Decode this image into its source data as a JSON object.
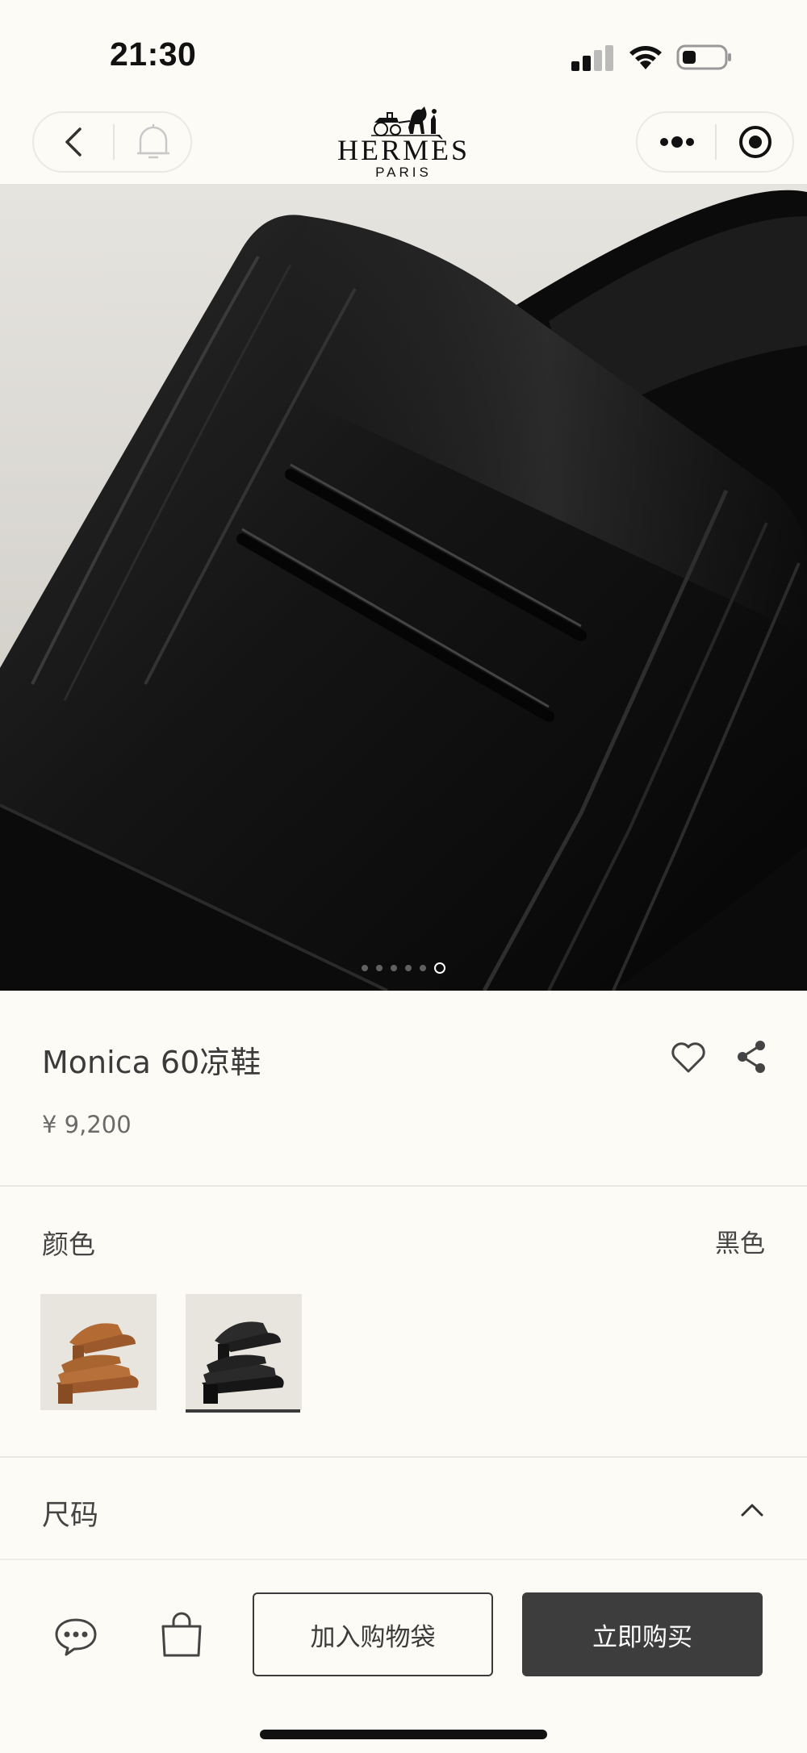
{
  "status_bar": {
    "time": "21:30",
    "icons": [
      "signal-icon",
      "wifi-icon",
      "battery-icon"
    ]
  },
  "header": {
    "brand": "HERMÈS",
    "brand_city": "PARIS",
    "left_icons": [
      "back-icon",
      "bell-icon"
    ],
    "right_icons": [
      "more-dots-icon",
      "target-icon"
    ]
  },
  "hero": {
    "carousel": {
      "count": 6,
      "active_index": 5
    }
  },
  "product": {
    "title": "Monica 60凉鞋",
    "price": "¥ 9,200",
    "icons": [
      "heart-icon",
      "share-icon"
    ]
  },
  "color": {
    "label": "颜色",
    "selected": "黑色",
    "swatches": [
      {
        "name": "tan",
        "color": "#a8602c"
      },
      {
        "name": "black",
        "color": "#1a1a1a",
        "selected": true
      }
    ]
  },
  "size": {
    "label": "尺码",
    "expanded": true
  },
  "actions": {
    "add_to_bag": "加入购物袋",
    "buy_now": "立即购买",
    "icons": [
      "chat-icon",
      "shopping-bag-icon"
    ]
  },
  "colors": {
    "background": "#fdfbf6",
    "text_primary": "#3b3b3b",
    "buy_button": "#3d3d3d"
  }
}
